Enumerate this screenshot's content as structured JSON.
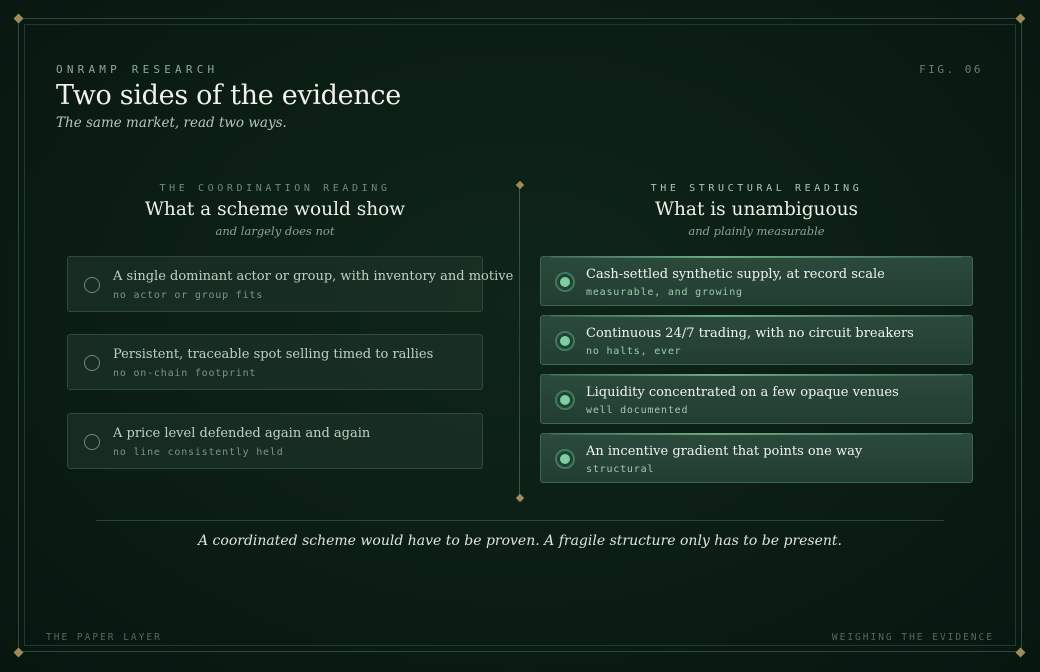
{
  "header": {
    "eyebrow": "ONRAMP RESEARCH",
    "fig_label": "FIG. 06",
    "title": "Two sides of the evidence",
    "subtitle": "The same market, read two ways."
  },
  "left_column": {
    "kicker": "THE COORDINATION READING",
    "heading": "What a scheme would show",
    "subheading": "and largely does not",
    "items": [
      {
        "text": "A single dominant actor or group, with inventory and motive",
        "note": "no actor or group fits"
      },
      {
        "text": "Persistent, traceable spot selling timed to rallies",
        "note": "no on-chain footprint"
      },
      {
        "text": "A price level defended again and again",
        "note": "no line consistently held"
      }
    ]
  },
  "right_column": {
    "kicker": "THE STRUCTURAL READING",
    "heading": "What is unambiguous",
    "subheading": "and plainly measurable",
    "items": [
      {
        "text": "Cash-settled synthetic supply, at record scale",
        "note": "measurable, and growing"
      },
      {
        "text": "Continuous 24/7 trading, with no circuit breakers",
        "note": "no halts, ever"
      },
      {
        "text": "Liquidity concentrated on a few opaque venues",
        "note": "well documented"
      },
      {
        "text": "An incentive gradient that points one way",
        "note": "structural"
      }
    ]
  },
  "conclusion": "A coordinated scheme would have to be proven. A fragile structure only has to be present.",
  "footer": {
    "left": "THE PAPER LAYER",
    "right": "WEIGHING THE EVIDENCE"
  },
  "colors": {
    "background": "#0b1d14",
    "accent_green": "#7dcf9f",
    "accent_gold": "#a08a5c"
  }
}
